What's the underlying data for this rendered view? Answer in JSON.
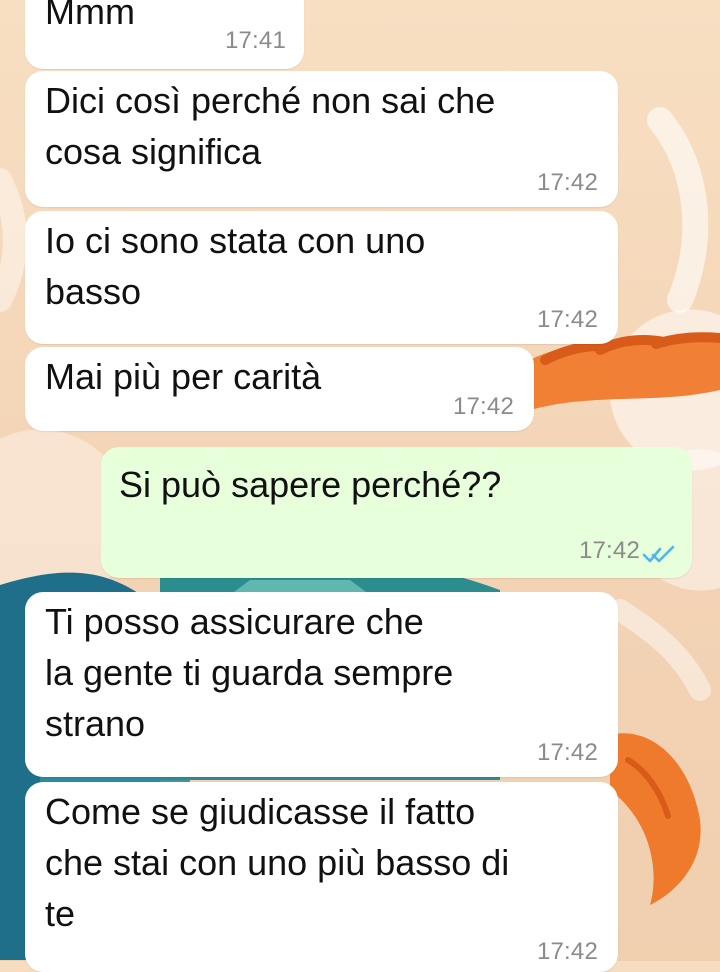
{
  "chat": {
    "messages": [
      {
        "direction": "incoming",
        "text": "Mmm",
        "time": "17:41"
      },
      {
        "direction": "incoming",
        "text": "Dici così perché non sai che\ncosa significa",
        "time": "17:42"
      },
      {
        "direction": "incoming",
        "text": "Io ci sono stata con uno\nbasso",
        "time": "17:42"
      },
      {
        "direction": "incoming",
        "text": "Mai più per carità",
        "time": "17:42"
      },
      {
        "direction": "outgoing",
        "text": "Si può sapere perché??",
        "time": "17:42",
        "status": "read"
      },
      {
        "direction": "incoming",
        "text": "Ti posso assicurare che\nla gente ti guarda sempre\nstrano",
        "time": "17:42"
      },
      {
        "direction": "incoming",
        "text": "Come se giudicasse il fatto\nche stai con uno più basso di\nte",
        "time": "17:42"
      }
    ]
  },
  "colors": {
    "incoming_bubble": "#ffffff",
    "outgoing_bubble": "#e7ffdb",
    "timestamp": "#8b8b8b",
    "read_ticks": "#4fb6ec"
  },
  "icons": {
    "read_receipt": "double-check-icon"
  }
}
